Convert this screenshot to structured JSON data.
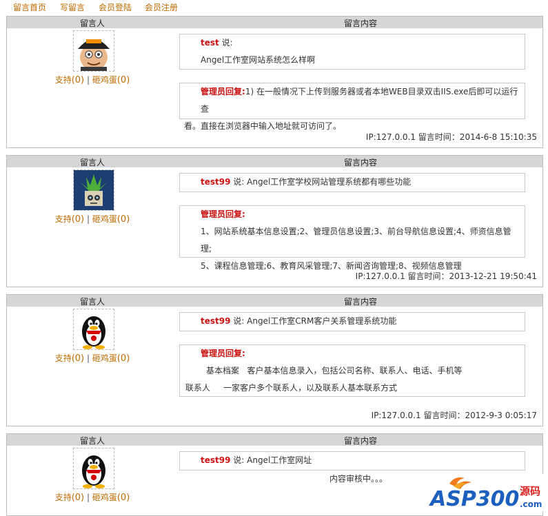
{
  "nav": [
    "留言首页",
    "写留言",
    "会员登陆",
    "会员注册"
  ],
  "header": {
    "col1": "留言人",
    "col2": "留言内容"
  },
  "vote": {
    "support": "支持",
    "egg": "砸鸡蛋",
    "sep": "|",
    "count_support": "(0)",
    "count_egg": "(0)"
  },
  "entries": [
    {
      "user": "test",
      "says": " 说:",
      "message": "Angel工作室网站系统怎么样啊",
      "reply_label": "管理员回复:",
      "reply_line1": "1) 在一般情况下上传到服务器或者本地WEB目录双击IIS.exe后即可以运行查",
      "reply_line2": "看。直接在浏览器中输入地址就可访问了。",
      "meta": "IP:127.0.0.1 留言时间：2014-6-8 15:10:35",
      "avatar": "cartoon-man-avatar"
    },
    {
      "user": "test99",
      "says": " 说:",
      "message": " Angel工作室学校网站管理系统都有哪些功能",
      "reply_label": "管理员回复:",
      "reply_line1": "1、网站系统基本信息设置;2、管理员信息设置;3、前台导航信息设置;4、师资信息管理;",
      "reply_line2": "5、课程信息管理;6、教育风采管理;7、新闻咨询管理;8、视频信息管理",
      "meta": "IP:127.0.0.1 留言时间：2013-12-21 19:50:41",
      "avatar": "plant-pot-avatar"
    },
    {
      "user": "test99",
      "says": " 说:",
      "message": " Angel工作室CRM客户关系管理系统功能",
      "reply_label": "管理员回复:",
      "reply_line1": "基本档案   客户基本信息录入，包括公司名称、联系人、电话、手机等",
      "reply_line2": "联系人     一家客户多个联系人，以及联系人基本联系方式",
      "meta": "IP:127.0.0.1 留言时间：2012-9-3 0:05:17",
      "avatar": "penguin-avatar"
    },
    {
      "user": "test99",
      "says": " 说:",
      "message": " Angel工作室网址",
      "pending": "内容审核中。。。",
      "avatar": "penguin-avatar"
    }
  ],
  "watermark": {
    "brand": "ASP300",
    "suffix": "源码",
    "domain": ".com"
  }
}
